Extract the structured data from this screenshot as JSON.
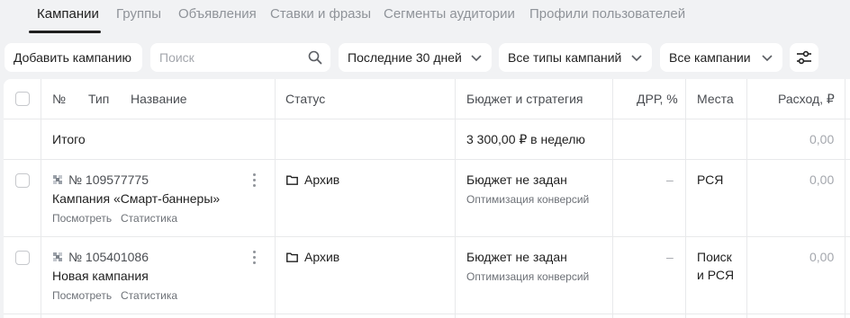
{
  "tabs": [
    {
      "label": "Кампании",
      "active": true
    },
    {
      "label": "Группы"
    },
    {
      "label": "Объявления"
    },
    {
      "label": "Ставки и фразы"
    },
    {
      "label": "Сегменты аудитории"
    },
    {
      "label": "Профили пользователей"
    }
  ],
  "toolbar": {
    "add_campaign": "Добавить кампанию",
    "search_placeholder": "Поиск",
    "period": "Последние 30 дней",
    "campaign_types": "Все типы кампаний",
    "campaigns_filter": "Все кампании"
  },
  "table": {
    "headers": {
      "number": "№",
      "type": "Тип",
      "name": "Название",
      "status": "Статус",
      "budget": "Бюджет и стратегия",
      "drr": "ДРР, %",
      "places": "Места",
      "spend": "Расход, ₽"
    },
    "total": {
      "label": "Итого",
      "budget": "3 300,00 ₽ в неделю",
      "spend": "0,00"
    },
    "rows": [
      {
        "number": "№ 109577775",
        "name": "Кампания «Смарт-баннеры»",
        "view_link": "Посмотреть",
        "stats_link": "Статистика",
        "status": "Архив",
        "budget": "Бюджет не задан",
        "strategy": "Оптимизация конверсий",
        "drr": "–",
        "places_line1": "РСЯ",
        "places_line2": "",
        "spend": "0,00"
      },
      {
        "number": "№ 105401086",
        "name": "Новая кампания",
        "view_link": "Посмотреть",
        "stats_link": "Статистика",
        "status": "Архив",
        "budget": "Бюджет не задан",
        "strategy": "Оптимизация конверсий",
        "drr": "–",
        "places_line1": "Поиск",
        "places_line2": "и РСЯ",
        "spend": "0,00"
      }
    ]
  }
}
